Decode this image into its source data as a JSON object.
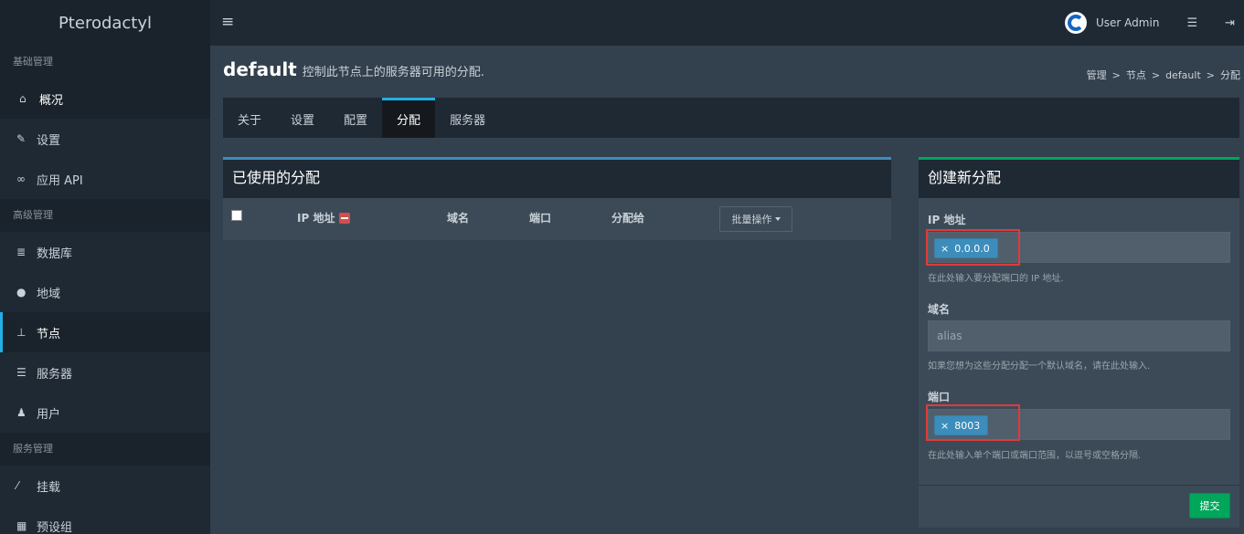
{
  "app": {
    "logo": "Pterodactyl"
  },
  "topbar": {
    "menu_icon": "hamburger-icon",
    "user_name": "User Admin",
    "icons": [
      "server-list-icon",
      "logout-icon"
    ]
  },
  "sidebar": {
    "sections": [
      {
        "header": "基础管理",
        "items": [
          {
            "label": "概况",
            "icon": "home-icon"
          },
          {
            "label": "设置",
            "icon": "wrench-icon"
          },
          {
            "label": "应用 API",
            "icon": "link-icon"
          }
        ]
      },
      {
        "header": "高级管理",
        "items": [
          {
            "label": "数据库",
            "icon": "database-icon"
          },
          {
            "label": "地域",
            "icon": "globe-icon"
          },
          {
            "label": "节点",
            "icon": "sitemap-icon"
          },
          {
            "label": "服务器",
            "icon": "server-icon"
          },
          {
            "label": "用户",
            "icon": "users-icon"
          }
        ]
      },
      {
        "header": "服务管理",
        "items": [
          {
            "label": "挂载",
            "icon": "magic-icon"
          },
          {
            "label": "预设组",
            "icon": "grid-icon"
          }
        ]
      }
    ]
  },
  "header": {
    "title": "default",
    "subtitle": "控制此节点上的服务器可用的分配.",
    "breadcrumb": [
      "管理",
      "节点",
      "default",
      "分配"
    ]
  },
  "tabs": [
    "关于",
    "设置",
    "配置",
    "分配",
    "服务器"
  ],
  "allocations_box": {
    "title": "已使用的分配",
    "columns": {
      "ip": "IP 地址",
      "alias": "域名",
      "port": "端口",
      "assigned": "分配给"
    },
    "bulk_button": "批量操作"
  },
  "create_box": {
    "title": "创建新分配",
    "ip_label": "IP 地址",
    "ip_tag": "0.0.0.0",
    "tag_remove": "×",
    "ip_help": "在此处输入要分配端口的 IP 地址.",
    "alias_label": "域名",
    "alias_placeholder": "alias",
    "alias_help": "如果您想为这些分配分配一个默认域名，请在此处输入.",
    "port_label": "端口",
    "port_tag": "8003",
    "port_help": "在此处输入单个端口或端口范围，以逗号或空格分隔.",
    "submit": "提交"
  },
  "colors": {
    "accent_blue": "#22aee8",
    "success_green": "#00a65a",
    "highlight_red": "#e03b3b",
    "tag_blue": "#3c8dbc"
  }
}
